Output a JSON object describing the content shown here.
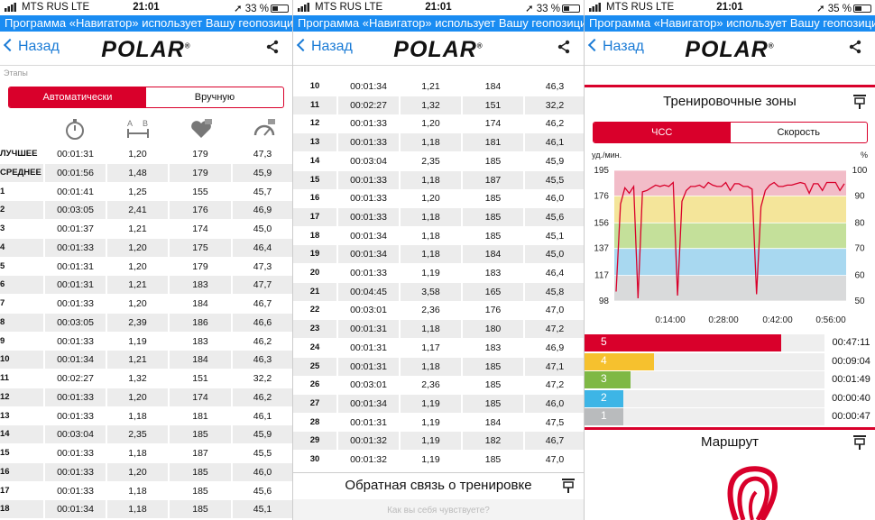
{
  "screens": [
    {
      "status": {
        "carrier": "MTS RUS  LTE",
        "time": "21:01",
        "battery": "33 %"
      }
    },
    {
      "status": {
        "carrier": "MTS RUS  LTE",
        "time": "21:01",
        "battery": "33 %"
      }
    },
    {
      "status": {
        "carrier": "MTS RUS  LTE",
        "time": "21:01",
        "battery": "35 %"
      }
    }
  ],
  "geo_banner": "Программа «Навигатор» использует Вашу геопозицию",
  "nav": {
    "back_label": "Назад",
    "logo": "POLAR"
  },
  "laps_panel": {
    "section_label": "Этапы",
    "toggle": {
      "auto": "Автоматически",
      "manual": "Вручную"
    },
    "rows": [
      [
        "ЛУЧШЕЕ",
        "00:01:31",
        "1,20",
        "179",
        "47,3"
      ],
      [
        "СРЕДНЕЕ",
        "00:01:56",
        "1,48",
        "179",
        "45,9"
      ],
      [
        "1",
        "00:01:41",
        "1,25",
        "155",
        "45,7"
      ],
      [
        "2",
        "00:03:05",
        "2,41",
        "176",
        "46,9"
      ],
      [
        "3",
        "00:01:37",
        "1,21",
        "174",
        "45,0"
      ],
      [
        "4",
        "00:01:33",
        "1,20",
        "175",
        "46,4"
      ],
      [
        "5",
        "00:01:31",
        "1,20",
        "179",
        "47,3"
      ],
      [
        "6",
        "00:01:31",
        "1,21",
        "183",
        "47,7"
      ],
      [
        "7",
        "00:01:33",
        "1,20",
        "184",
        "46,7"
      ],
      [
        "8",
        "00:03:05",
        "2,39",
        "186",
        "46,6"
      ],
      [
        "9",
        "00:01:33",
        "1,19",
        "183",
        "46,2"
      ],
      [
        "10",
        "00:01:34",
        "1,21",
        "184",
        "46,3"
      ],
      [
        "11",
        "00:02:27",
        "1,32",
        "151",
        "32,2"
      ],
      [
        "12",
        "00:01:33",
        "1,20",
        "174",
        "46,2"
      ],
      [
        "13",
        "00:01:33",
        "1,18",
        "181",
        "46,1"
      ],
      [
        "14",
        "00:03:04",
        "2,35",
        "185",
        "45,9"
      ],
      [
        "15",
        "00:01:33",
        "1,18",
        "187",
        "45,5"
      ],
      [
        "16",
        "00:01:33",
        "1,20",
        "185",
        "46,0"
      ],
      [
        "17",
        "00:01:33",
        "1,18",
        "185",
        "45,6"
      ],
      [
        "18",
        "00:01:34",
        "1,18",
        "185",
        "45,1"
      ]
    ]
  },
  "laps_panel2": {
    "rows": [
      [
        "10",
        "00:01:34",
        "1,21",
        "184",
        "46,3"
      ],
      [
        "11",
        "00:02:27",
        "1,32",
        "151",
        "32,2"
      ],
      [
        "12",
        "00:01:33",
        "1,20",
        "174",
        "46,2"
      ],
      [
        "13",
        "00:01:33",
        "1,18",
        "181",
        "46,1"
      ],
      [
        "14",
        "00:03:04",
        "2,35",
        "185",
        "45,9"
      ],
      [
        "15",
        "00:01:33",
        "1,18",
        "187",
        "45,5"
      ],
      [
        "16",
        "00:01:33",
        "1,20",
        "185",
        "46,0"
      ],
      [
        "17",
        "00:01:33",
        "1,18",
        "185",
        "45,6"
      ],
      [
        "18",
        "00:01:34",
        "1,18",
        "185",
        "45,1"
      ],
      [
        "19",
        "00:01:34",
        "1,18",
        "184",
        "45,0"
      ],
      [
        "20",
        "00:01:33",
        "1,19",
        "183",
        "46,4"
      ],
      [
        "21",
        "00:04:45",
        "3,58",
        "165",
        "45,8"
      ],
      [
        "22",
        "00:03:01",
        "2,36",
        "176",
        "47,0"
      ],
      [
        "23",
        "00:01:31",
        "1,18",
        "180",
        "47,2"
      ],
      [
        "24",
        "00:01:31",
        "1,17",
        "183",
        "46,9"
      ],
      [
        "25",
        "00:01:31",
        "1,18",
        "185",
        "47,1"
      ],
      [
        "26",
        "00:03:01",
        "2,36",
        "185",
        "47,2"
      ],
      [
        "27",
        "00:01:34",
        "1,19",
        "185",
        "46,0"
      ],
      [
        "28",
        "00:01:31",
        "1,19",
        "184",
        "47,5"
      ],
      [
        "29",
        "00:01:32",
        "1,19",
        "182",
        "46,7"
      ],
      [
        "30",
        "00:01:32",
        "1,19",
        "185",
        "47,0"
      ]
    ],
    "feedback_title": "Обратная связь о тренировке",
    "feedback_sub": "Как вы себя чувствуете?"
  },
  "zones_panel": {
    "title": "Тренировочные зоны",
    "toggle": {
      "hr": "ЧСС",
      "speed": "Скорость"
    },
    "y_left_label": "уд./мин.",
    "y_right_label": "%",
    "y_left_ticks": [
      "195",
      "176",
      "156",
      "137",
      "117",
      "98"
    ],
    "y_right_ticks": [
      "100",
      "90",
      "80",
      "70",
      "60",
      "50"
    ],
    "x_ticks": [
      "0:14:00",
      "0:28:00",
      "0:42:00",
      "0:56:00"
    ],
    "zone_colors": [
      "#d9dadb",
      "#a8d8f0",
      "#c4e09a",
      "#f4e59a",
      "#f2bcc8"
    ],
    "zones": [
      {
        "n": "5",
        "color": "#d9002b",
        "fraction": 0.82,
        "time": "00:47:11"
      },
      {
        "n": "4",
        "color": "#f6c12e",
        "fraction": 0.29,
        "time": "00:09:04"
      },
      {
        "n": "3",
        "color": "#7fb845",
        "fraction": 0.19,
        "time": "00:01:49"
      },
      {
        "n": "2",
        "color": "#3db5e6",
        "fraction": 0.16,
        "time": "00:00:40"
      },
      {
        "n": "1",
        "color": "#b9bbbd",
        "fraction": 0.16,
        "time": "00:00:47"
      }
    ],
    "route_title": "Маршрут"
  },
  "chart_data": {
    "type": "line",
    "series": [
      {
        "values": [
          105,
          170,
          182,
          178,
          183,
          100,
          179,
          180,
          182,
          184,
          183,
          184,
          183,
          186,
          102,
          172,
          180,
          183,
          183,
          184,
          182,
          186,
          184,
          183,
          183,
          186,
          180,
          185,
          185,
          183,
          183,
          181,
          103,
          168,
          180,
          184,
          186,
          183,
          183,
          184,
          184,
          185,
          186,
          185,
          178,
          185,
          185,
          180,
          186,
          186,
          186,
          180,
          185
        ]
      }
    ],
    "ylim": [
      95,
      198
    ],
    "grid": true
  },
  "colors": {
    "accent": "#d9002b",
    "link": "#1a7bd6",
    "banner": "#1a8cf2"
  }
}
